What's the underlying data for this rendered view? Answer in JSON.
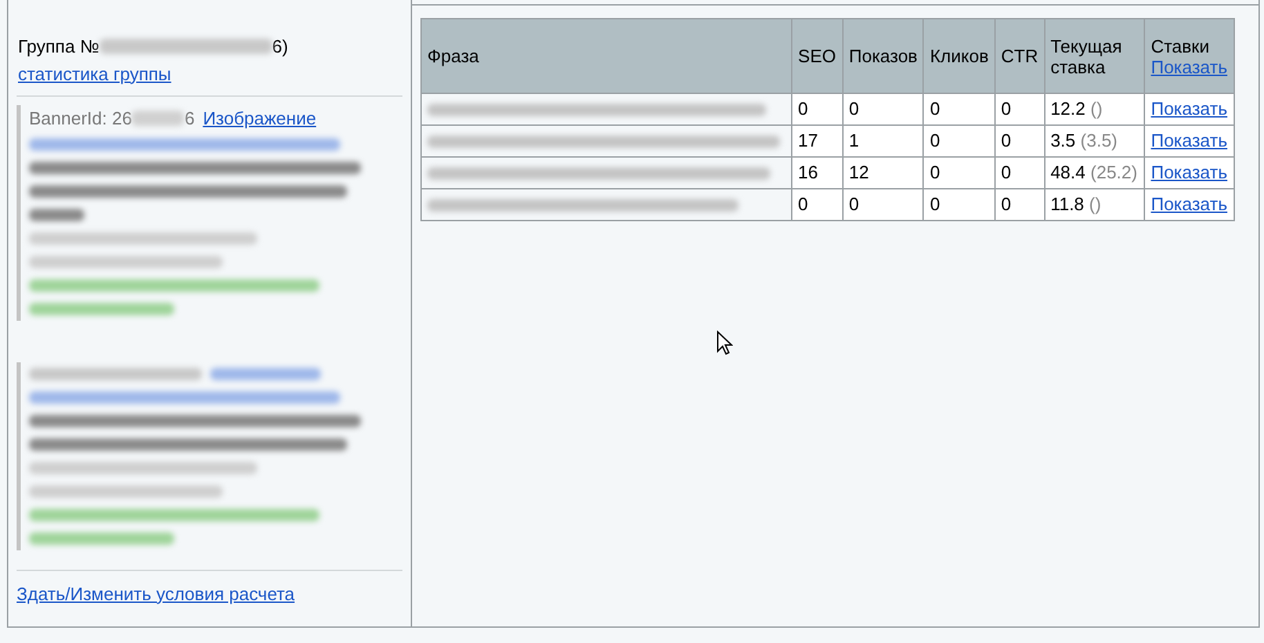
{
  "group": {
    "title_start": "Группа №",
    "title_end": "6)",
    "stats_link": "статистика группы"
  },
  "banners": [
    {
      "kind": "partial",
      "id_start": "BannerId: 26",
      "id_end": "6",
      "image_link": "Изображение"
    },
    {
      "kind": "blurred"
    }
  ],
  "footer_link": "Здать/Изменить условия расчета",
  "table": {
    "columns": [
      "Фраза",
      "SEO",
      "Показов",
      "Кликов",
      "CTR",
      "Текущая ставка",
      "Ставки"
    ],
    "header_link": "Показать",
    "rows": [
      {
        "seo": "0",
        "shows": "0",
        "clicks": "0",
        "ctr": "0",
        "bid": "12.2",
        "bid_extra": "()",
        "link": "Показать"
      },
      {
        "seo": "17",
        "shows": "1",
        "clicks": "0",
        "ctr": "0",
        "bid": "3.5",
        "bid_extra": "(3.5)",
        "link": "Показать"
      },
      {
        "seo": "16",
        "shows": "12",
        "clicks": "0",
        "ctr": "0",
        "bid": "48.4",
        "bid_extra": "(25.2)",
        "link": "Показать"
      },
      {
        "seo": "0",
        "shows": "0",
        "clicks": "0",
        "ctr": "0",
        "bid": "11.8",
        "bid_extra": "()",
        "link": "Показать"
      }
    ]
  }
}
